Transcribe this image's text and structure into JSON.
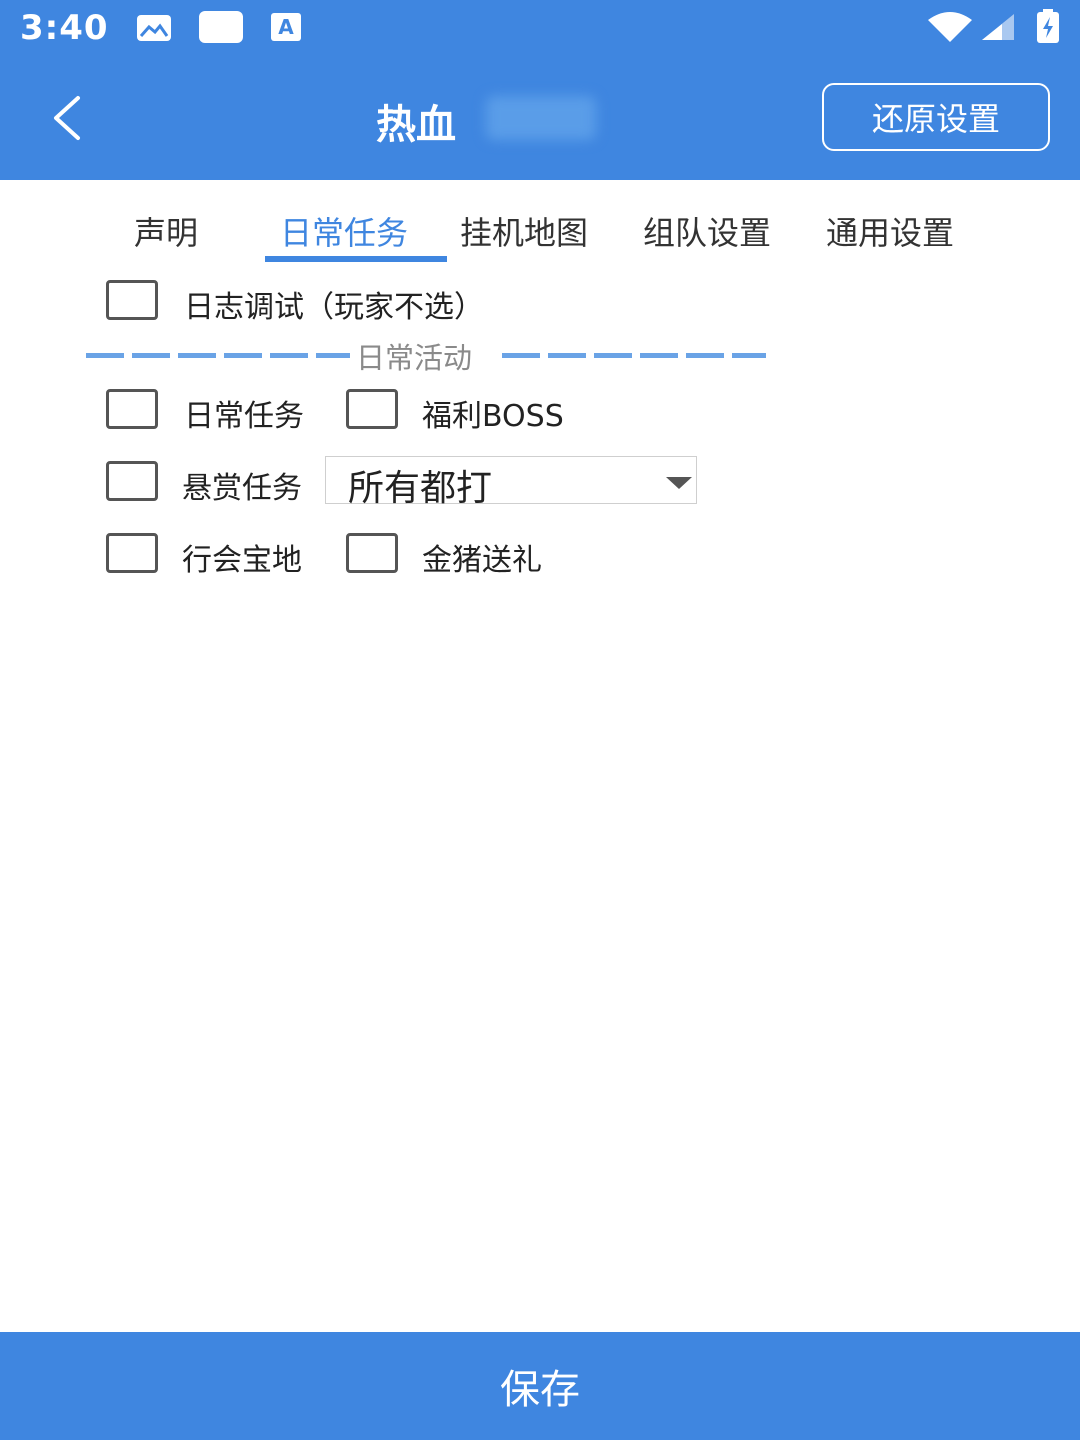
{
  "status_bar": {
    "time": "3:40",
    "icons": [
      "image-icon",
      "notification-box-icon",
      "text-icon",
      "wifi-icon",
      "signal-icon",
      "battery-icon"
    ]
  },
  "header": {
    "back_icon": "chevron-left-icon",
    "title": "热血",
    "restore_label": "还原设置"
  },
  "tabs": [
    {
      "label": "声明"
    },
    {
      "label": "日常任务",
      "active": true
    },
    {
      "label": "挂机地图"
    },
    {
      "label": "组队设置"
    },
    {
      "label": "通用设置"
    }
  ],
  "options": {
    "log_debug": {
      "label": "日志调试（玩家不选）",
      "checked": false
    },
    "section_label": "日常活动",
    "daily_task": {
      "label": "日常任务",
      "checked": false
    },
    "welfare_boss": {
      "label": "福利BOSS",
      "checked": false
    },
    "bounty_task": {
      "label": "悬赏任务",
      "checked": false
    },
    "bounty_select": {
      "value": "所有都打"
    },
    "guild_treasure": {
      "label": "行会宝地",
      "checked": false
    },
    "golden_pig": {
      "label": "金猪送礼",
      "checked": false
    }
  },
  "footer": {
    "save_label": "保存"
  },
  "colors": {
    "primary": "#3f86e0",
    "divider": "#6aa3e6"
  }
}
